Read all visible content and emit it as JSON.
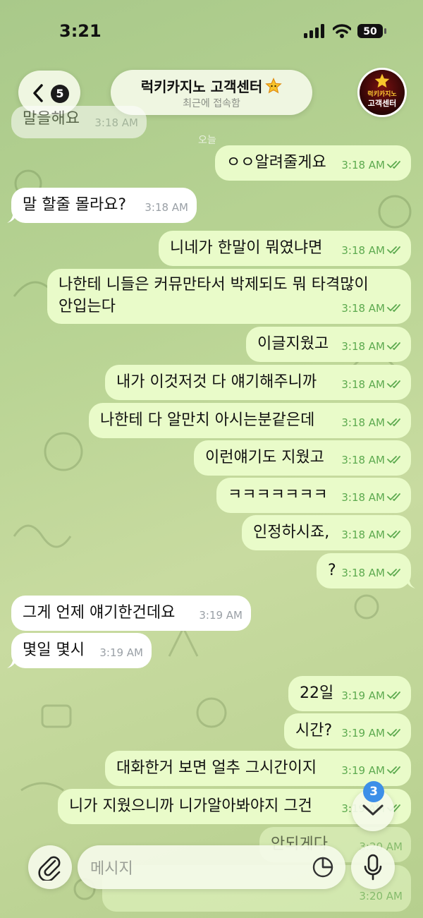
{
  "status_bar": {
    "time": "3:21",
    "battery": "50"
  },
  "header": {
    "back_badge": "5",
    "title": "럭키카지노 고객센터",
    "subtitle": "최근에 접속함",
    "avatar_line1": "럭키카지노",
    "avatar_line2": "고객센터"
  },
  "date_label": "오늘",
  "messages": [
    {
      "dir": "in",
      "text": "말을해요",
      "time": "3:18 AM"
    },
    {
      "dir": "out",
      "text": "ㅇㅇ알려줄게요",
      "time": "3:18 AM"
    },
    {
      "dir": "in",
      "text": "말 할줄 몰라요?",
      "time": "3:18 AM"
    },
    {
      "dir": "out",
      "text": "니네가 한말이 뭐였냐면",
      "time": "3:18 AM"
    },
    {
      "dir": "out",
      "text": "나한테 니들은 커뮤만타서 박제되도 뭐 타격많이",
      "text2": "안입는다",
      "time": "3:18 AM"
    },
    {
      "dir": "out",
      "text": "이글지웠고",
      "time": "3:18 AM"
    },
    {
      "dir": "out",
      "text": "내가 이것저것 다 얘기해주니까",
      "time": "3:18 AM"
    },
    {
      "dir": "out",
      "text": "나한테 다 알만치 아시는분같은데",
      "time": "3:18 AM"
    },
    {
      "dir": "out",
      "text": "이런얘기도 지웠고",
      "time": "3:18 AM"
    },
    {
      "dir": "out",
      "text": "ㅋㅋㅋㅋㅋㅋㅋ",
      "time": "3:18 AM"
    },
    {
      "dir": "out",
      "text": "인정하시죠,",
      "time": "3:18 AM"
    },
    {
      "dir": "out",
      "text": "?",
      "time": "3:18 AM"
    },
    {
      "dir": "in",
      "text": "그게 언제 얘기한건데요",
      "time": "3:19 AM"
    },
    {
      "dir": "in",
      "text": "몇일 몇시",
      "time": "3:19 AM"
    },
    {
      "dir": "out",
      "text": "22일",
      "time": "3:19 AM"
    },
    {
      "dir": "out",
      "text": "시간?",
      "time": "3:19 AM"
    },
    {
      "dir": "out",
      "text": "대화한거 보면 얼추 그시간이지",
      "time": "3:19 AM"
    },
    {
      "dir": "out",
      "text": "니가 지웠으니까 니가알아봐야지 그건",
      "time": "3:19 AM"
    },
    {
      "dir": "out",
      "text": "안되게다",
      "time": "3:20 AM"
    },
    {
      "dir": "out",
      "text": "",
      "time": "3:20 AM"
    }
  ],
  "scroll_badge": "3",
  "input": {
    "placeholder": "메시지"
  },
  "icons": {
    "back": "chevron-left-icon",
    "star": "star-icon",
    "scroll": "chevron-down-icon",
    "attach": "paperclip-icon",
    "sticker": "sticker-icon",
    "mic": "mic-icon",
    "read": "double-check-icon"
  },
  "colors": {
    "incoming_bubble": "#ffffff",
    "outgoing_bubble": "#e9fbc9",
    "outgoing_meta": "#5daa4f",
    "badge": "#3d8fe8"
  }
}
